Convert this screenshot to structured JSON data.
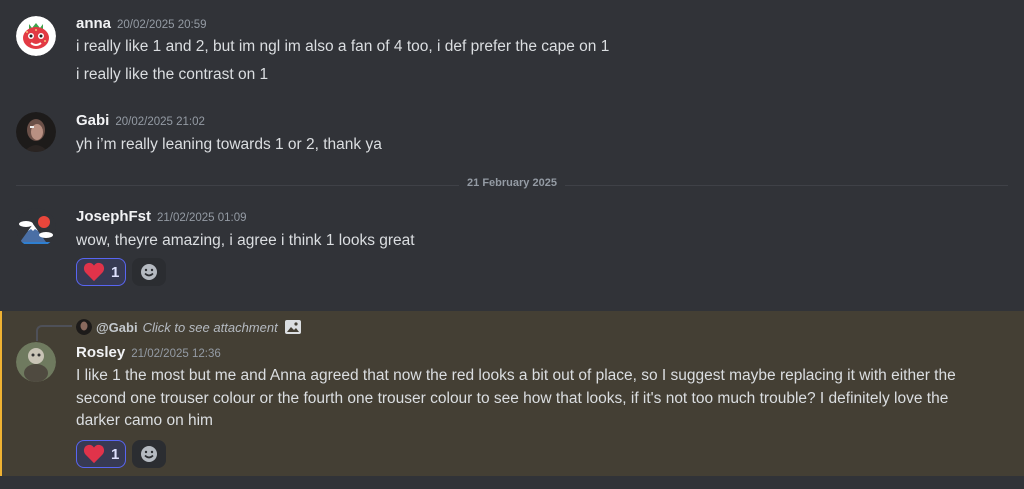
{
  "messages": [
    {
      "author": "anna",
      "timestamp": "20/02/2025 20:59",
      "lines": [
        "i really like 1 and 2, but im ngl im also a fan of 4 too, i def prefer the cape on 1",
        "i really like the contrast on 1"
      ]
    },
    {
      "author": "Gabi",
      "timestamp": "20/02/2025 21:02",
      "lines": [
        "yh i’m really leaning towards 1 or 2, thank ya"
      ]
    },
    {
      "author": "JosephFst",
      "timestamp": "21/02/2025 01:09",
      "lines": [
        "wow, theyre amazing, i agree i think 1 looks great"
      ],
      "reaction": {
        "emoji": "heart-icon",
        "count": "1"
      }
    },
    {
      "author": "Rosley",
      "timestamp": "21/02/2025 12:36",
      "reply": {
        "mention": "@Gabi",
        "hint": "Click to see attachment"
      },
      "body": "I like 1 the most but me and Anna agreed that now the red looks a bit out of place, so I suggest maybe replacing it with either the second one trouser colour or the fourth one trouser colour to see how that looks, if it's not too much trouble? I definitely love the darker camo on him",
      "reaction": {
        "emoji": "heart-icon",
        "count": "1"
      }
    }
  ],
  "divider": {
    "label": "21 February 2025"
  },
  "colors": {
    "background": "#313338",
    "mention_highlight": "#443f34",
    "highlight_bar": "#f0b232",
    "reaction_border": "#5865f2",
    "heart": "#e0334a"
  }
}
